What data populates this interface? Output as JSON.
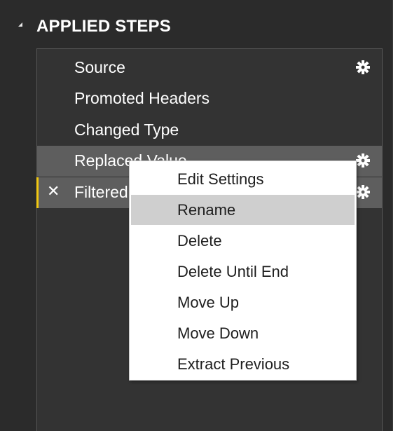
{
  "panel": {
    "title": "APPLIED STEPS"
  },
  "steps": [
    {
      "label": "Source",
      "has_settings": true,
      "state": "normal"
    },
    {
      "label": "Promoted Headers",
      "has_settings": false,
      "state": "normal"
    },
    {
      "label": "Changed Type",
      "has_settings": false,
      "state": "normal"
    },
    {
      "label": "Replaced Value",
      "has_settings": true,
      "state": "context-target"
    },
    {
      "label": "Filtered Rows",
      "has_settings": true,
      "state": "selected"
    }
  ],
  "context_menu": {
    "items": [
      {
        "label": "Edit Settings",
        "hovered": false
      },
      {
        "label": "Rename",
        "hovered": true
      },
      {
        "label": "Delete",
        "hovered": false
      },
      {
        "label": "Delete Until End",
        "hovered": false
      },
      {
        "label": "Move Up",
        "hovered": false
      },
      {
        "label": "Move Down",
        "hovered": false
      },
      {
        "label": "Extract Previous",
        "hovered": false
      }
    ]
  },
  "colors": {
    "panel_bg": "#2b2b2b",
    "steps_bg": "#333333",
    "highlight_bg": "#5e5e5e",
    "active_marker": "#f2c811",
    "menu_hover": "#cfcfcf"
  },
  "icons": {
    "collapse": "triangle-collapse-icon",
    "settings": "gear-icon",
    "delete": "close-icon"
  }
}
